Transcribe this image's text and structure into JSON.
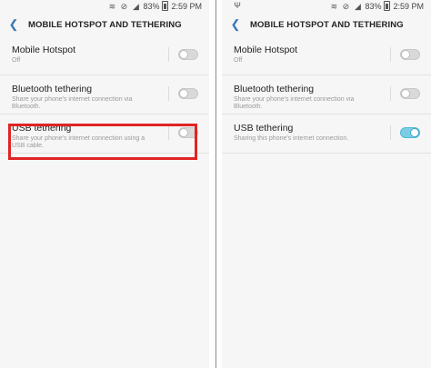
{
  "status": {
    "battery": "83%",
    "time": "2:59 PM"
  },
  "header": {
    "title": "MOBILE HOTSPOT AND TETHERING"
  },
  "left": {
    "rows": [
      {
        "title": "Mobile Hotspot",
        "subtitle": "Off",
        "state": "off"
      },
      {
        "title": "Bluetooth tethering",
        "subtitle": "Share your phone's internet connection via Bluetooth.",
        "state": "off"
      },
      {
        "title": "USB tethering",
        "subtitle": "Share your phone's internet connection using a USB cable.",
        "state": "off"
      }
    ]
  },
  "right": {
    "rows": [
      {
        "title": "Mobile Hotspot",
        "subtitle": "Off",
        "state": "off"
      },
      {
        "title": "Bluetooth tethering",
        "subtitle": "Share your phone's internet connection via Bluetooth.",
        "state": "off"
      },
      {
        "title": "USB tethering",
        "subtitle": "Sharing this phone's internet connection.",
        "state": "on"
      }
    ]
  },
  "colors": {
    "accent": "#3a7ab7",
    "toggle_on": "#4fb8d8",
    "highlight": "#e02424"
  },
  "icons": [
    "back-arrow-icon",
    "wifi-icon",
    "mute-icon",
    "signal-icon",
    "battery-icon",
    "usb-icon"
  ]
}
